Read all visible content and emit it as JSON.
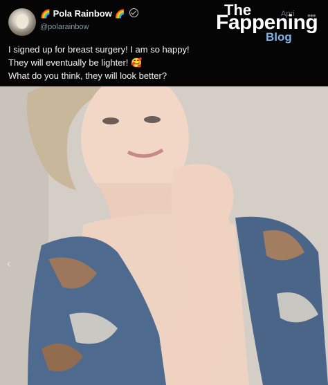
{
  "post": {
    "author": {
      "name": "Pola Rainbow",
      "emoji_left": "🌈",
      "emoji_right": "🌈",
      "handle": "@polarainbow",
      "verified_icon": "verified-check-icon"
    },
    "date_partial": "Apri",
    "lines": [
      "I signed up for breast surgery! I am so happy!",
      "They will eventually be lighter! 🥰",
      "What do you think, they will look better?"
    ]
  },
  "watermark": {
    "the": "The",
    "main": "Fappening",
    "blog": "Blog"
  },
  "colors": {
    "header_bg": "#050505",
    "watermark_blog": "#7fb2e8",
    "handle": "#8b98a5"
  }
}
